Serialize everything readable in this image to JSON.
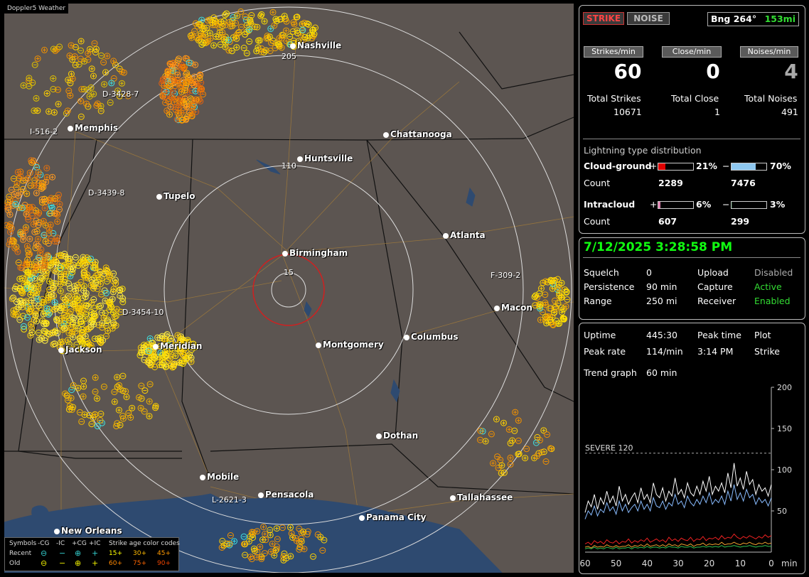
{
  "brand": "Doppler5 Weather",
  "map": {
    "cities": [
      {
        "name": "Nashville"
      },
      {
        "name": "Memphis"
      },
      {
        "name": "Chattanooga"
      },
      {
        "name": "Huntsville"
      },
      {
        "name": "Tupelo"
      },
      {
        "name": "Atlanta"
      },
      {
        "name": "Birmingham"
      },
      {
        "name": "Macon"
      },
      {
        "name": "Jackson"
      },
      {
        "name": "Meridian"
      },
      {
        "name": "Montgomery"
      },
      {
        "name": "Columbus"
      },
      {
        "name": "Dothan"
      },
      {
        "name": "Mobile"
      },
      {
        "name": "Pensacola"
      },
      {
        "name": "Tallahassee"
      },
      {
        "name": "Panama City"
      },
      {
        "name": "New Orleans"
      }
    ],
    "routes": [
      "205",
      "110",
      "15"
    ],
    "storm_tags": [
      "D-3428-7",
      "I-516-2",
      "D-3439-8",
      "D-3454-10",
      "F-309-2",
      "L-2621-3"
    ]
  },
  "legend": {
    "row0": [
      "Symbols",
      "-CG",
      "-IC",
      "+CG",
      "+IC",
      "Strike age color codes"
    ],
    "recent_label": "Recent",
    "old_label": "Old",
    "recent_ages": [
      "15+",
      "30+",
      "45+"
    ],
    "old_ages": [
      "60+",
      "75+",
      "90+"
    ]
  },
  "status": {
    "strike": "STRIKE",
    "noise": "NOISE",
    "bearing": "Bng 264°",
    "distance": "153mi"
  },
  "rates": {
    "labels": [
      "Strikes/min",
      "Close/min",
      "Noises/min"
    ],
    "values": [
      "60",
      "0",
      "4"
    ],
    "total_labels": [
      "Total Strikes",
      "Total Close",
      "Total Noises"
    ],
    "totals": [
      "10671",
      "1",
      "491"
    ]
  },
  "distribution": {
    "title": "Lightning type distribution",
    "cg_label": "Cloud-ground",
    "ic_label": "Intracloud",
    "count_label": "Count",
    "plus": "+",
    "minus": "−",
    "cg_pos_pct": "21%",
    "cg_neg_pct": "70%",
    "cg_pos_count": "2289",
    "cg_neg_count": "7476",
    "ic_pos_pct": "6%",
    "ic_neg_pct": "3%",
    "ic_pos_count": "607",
    "ic_neg_count": "299",
    "fractions": {
      "cg_pos": 0.21,
      "cg_neg": 0.7,
      "ic_pos": 0.06,
      "ic_neg": 0.03
    },
    "colors": {
      "cg_pos": "#e00000",
      "cg_neg": "#8ec8f0",
      "ic_pos": "#e080b0",
      "ic_neg": "#104020"
    }
  },
  "settings": {
    "datetime": "7/12/2025 3:28:58 PM",
    "squelch_label": "Squelch",
    "squelch": "0",
    "persistence_label": "Persistence",
    "persistence": "90 min",
    "range_label": "Range",
    "range": "250 mi",
    "upload_label": "Upload",
    "upload": "Disabled",
    "capture_label": "Capture",
    "capture": "Active",
    "receiver_label": "Receiver",
    "receiver": "Enabled"
  },
  "stats": {
    "uptime_label": "Uptime",
    "uptime": "445:30",
    "peak_time_label": "Peak time",
    "peak_time": "3:14 PM",
    "plot_label": "Plot",
    "plot": "Strike",
    "peak_rate_label": "Peak rate",
    "peak_rate": "114/min",
    "trend_label": "Trend graph",
    "trend": "60 min"
  },
  "chart_data": {
    "type": "line",
    "x_label": "min",
    "x_ticks": [
      "60",
      "50",
      "40",
      "30",
      "20",
      "10",
      "0"
    ],
    "y_ticks": [
      "200",
      "150",
      "100",
      "50"
    ],
    "ylim": [
      0,
      200
    ],
    "severe_label": "SEVERE 120",
    "severe_value": 120,
    "series": [
      {
        "color": "#ffffff",
        "values": [
          48,
          62,
          55,
          70,
          52,
          66,
          58,
          74,
          60,
          68,
          56,
          80,
          62,
          70,
          58,
          66,
          72,
          60,
          78,
          64,
          70,
          60,
          84,
          70,
          66,
          78,
          62,
          74,
          68,
          90,
          70,
          76,
          66,
          84,
          72,
          68,
          80,
          70,
          86,
          74,
          92,
          70,
          80,
          74,
          84,
          72,
          96,
          78,
          108,
          80,
          90,
          76,
          98,
          82,
          88,
          70,
          82,
          74,
          78,
          68,
          82
        ]
      },
      {
        "color": "#88bbff",
        "values": [
          40,
          50,
          45,
          56,
          44,
          52,
          48,
          60,
          50,
          55,
          46,
          62,
          50,
          58,
          48,
          54,
          58,
          50,
          62,
          52,
          58,
          50,
          66,
          56,
          54,
          62,
          52,
          60,
          56,
          70,
          58,
          62,
          54,
          68,
          60,
          56,
          64,
          58,
          68,
          60,
          72,
          58,
          64,
          60,
          68,
          58,
          74,
          62,
          82,
          64,
          72,
          62,
          76,
          66,
          70,
          58,
          66,
          60,
          64,
          56,
          66
        ]
      },
      {
        "color": "#ee2222",
        "values": [
          10,
          12,
          9,
          14,
          11,
          13,
          10,
          15,
          12,
          11,
          14,
          10,
          13,
          12,
          16,
          11,
          14,
          12,
          15,
          13,
          17,
          12,
          14,
          16,
          13,
          15,
          12,
          18,
          14,
          16,
          13,
          17,
          15,
          14,
          18,
          13,
          16,
          15,
          19,
          14,
          17,
          16,
          18,
          15,
          20,
          16,
          18,
          17,
          22,
          18,
          16,
          19,
          17,
          20,
          18,
          16,
          19,
          17,
          21,
          18,
          20
        ]
      },
      {
        "color": "#f0a030",
        "values": [
          6,
          7,
          5,
          8,
          6,
          7,
          6,
          9,
          7,
          6,
          8,
          6,
          7,
          7,
          9,
          6,
          8,
          7,
          9,
          7,
          10,
          7,
          8,
          9,
          7,
          9,
          7,
          10,
          8,
          9,
          7,
          10,
          9,
          8,
          10,
          7,
          9,
          9,
          11,
          8,
          10,
          9,
          10,
          9,
          12,
          9,
          10,
          10,
          12,
          10,
          9,
          11,
          10,
          12,
          10,
          9,
          11,
          10,
          12,
          10,
          11
        ]
      },
      {
        "color": "#30c050",
        "values": [
          4,
          5,
          4,
          6,
          4,
          5,
          4,
          6,
          5,
          4,
          6,
          4,
          5,
          5,
          6,
          4,
          6,
          5,
          6,
          5,
          7,
          5,
          6,
          6,
          5,
          6,
          5,
          7,
          6,
          6,
          5,
          7,
          6,
          6,
          7,
          5,
          6,
          6,
          7,
          6,
          7,
          6,
          7,
          6,
          8,
          6,
          7,
          7,
          8,
          7,
          6,
          7,
          7,
          8,
          7,
          6,
          7,
          7,
          8,
          7,
          7
        ]
      }
    ]
  }
}
